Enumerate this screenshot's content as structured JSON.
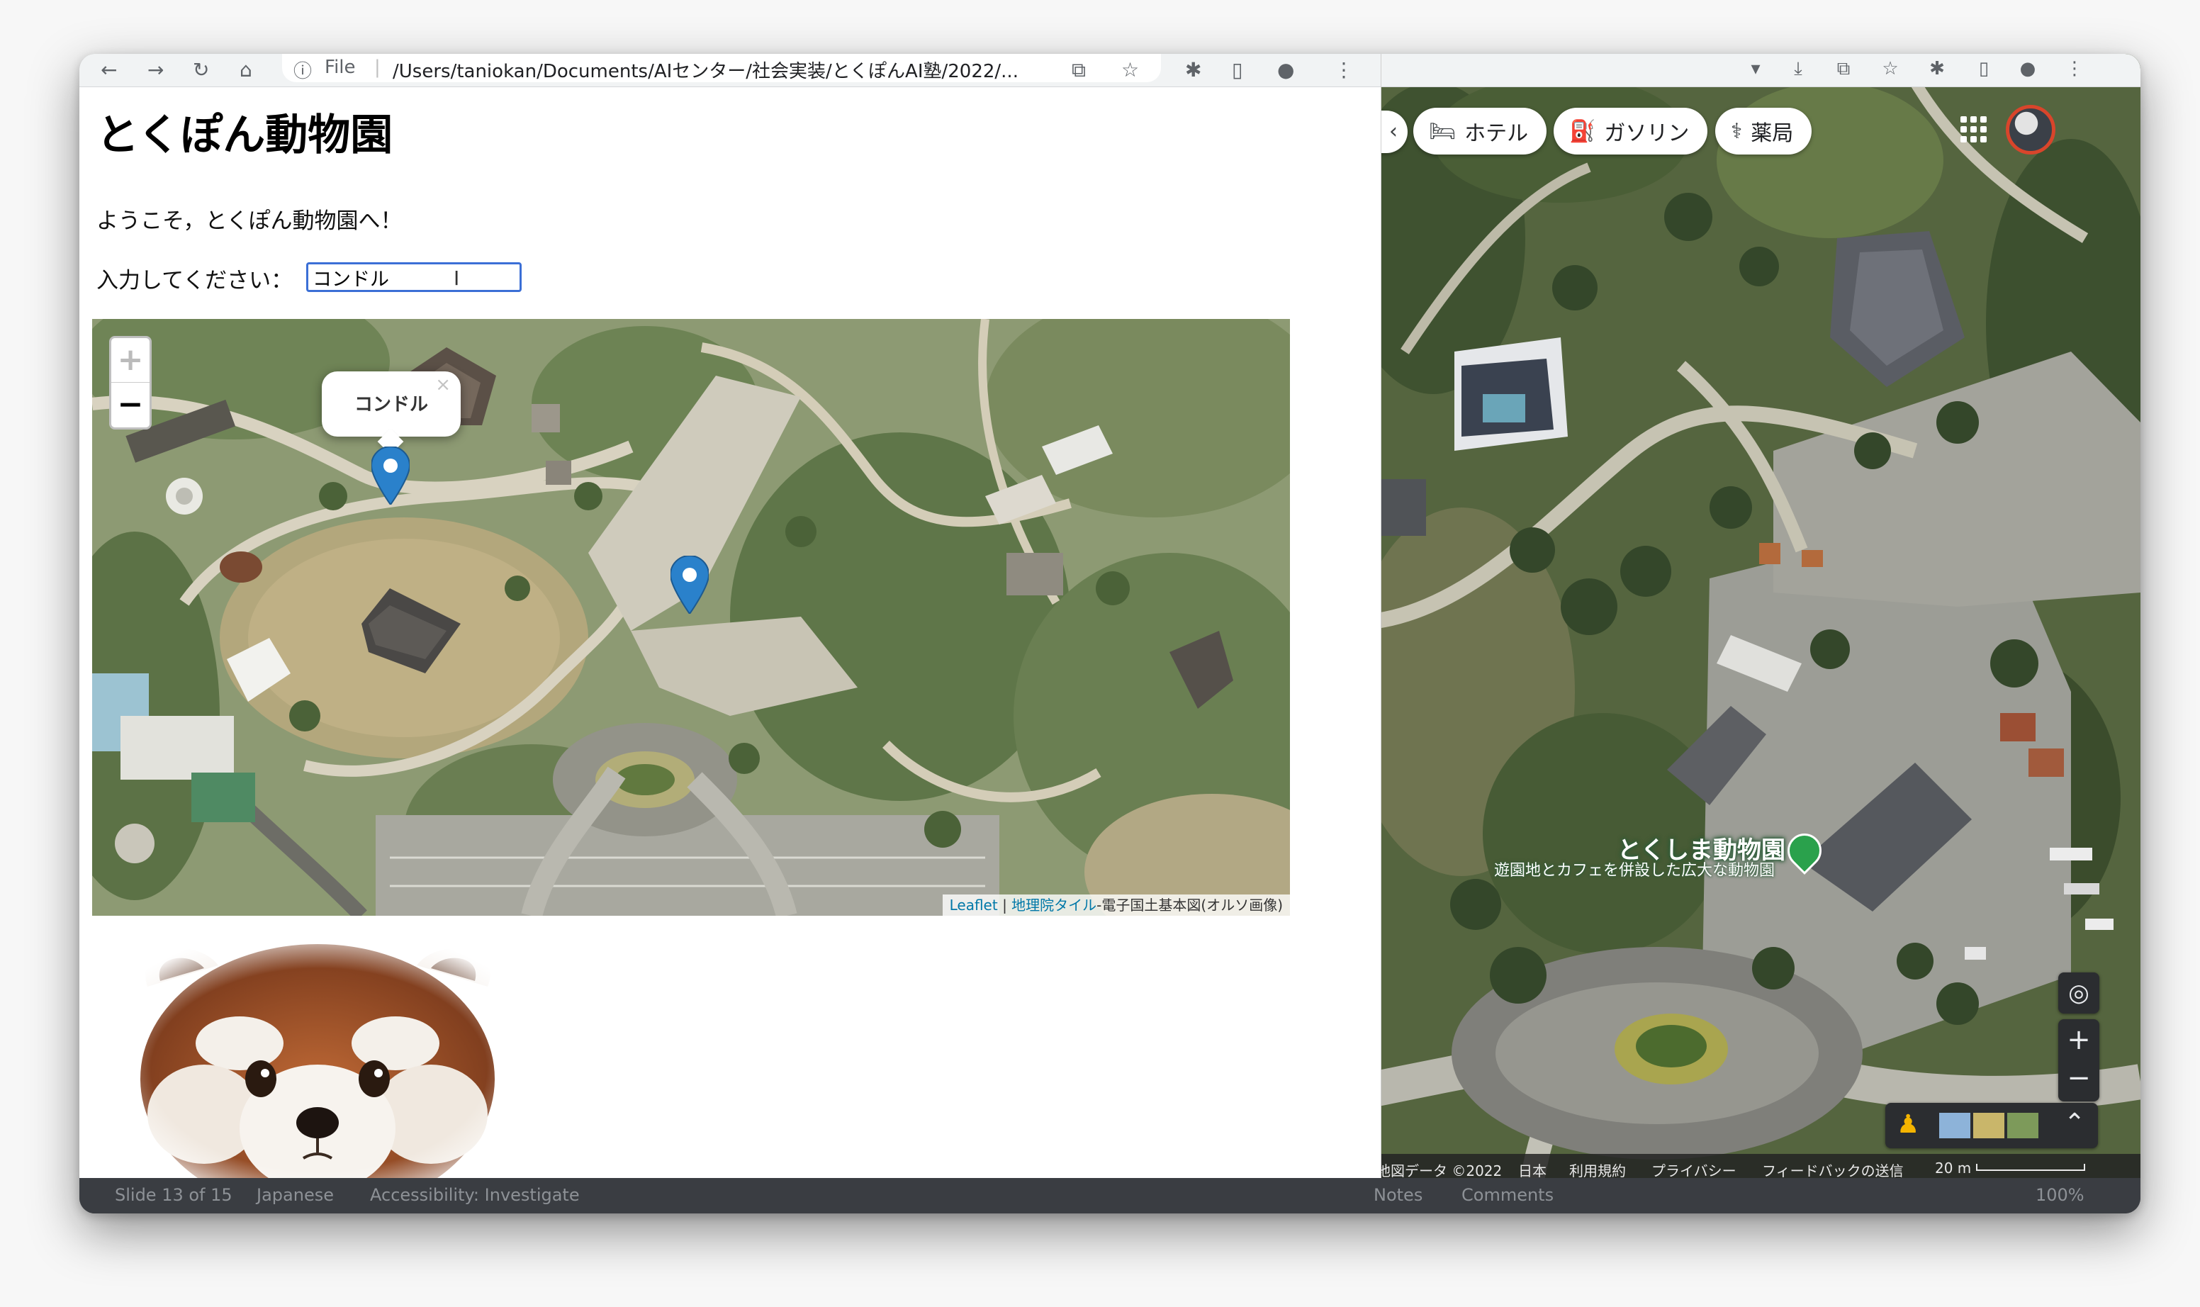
{
  "browser": {
    "omnibox": {
      "scheme_label": "File",
      "url": "/Users/taniokan/Documents/AIセンター/社会実装/とくぽんAI塾/2022/..."
    },
    "page": {
      "title": "とくぽん動物園",
      "welcome": "ようこそ，とくぽん動物園へ！",
      "input_label": "入力してください：",
      "input_value": "コンドル",
      "map": {
        "zoom_in": "+",
        "zoom_out": "−",
        "popup_text": "コンドル",
        "popup_close": "×",
        "markers": [
          "condor-marker",
          "zoo-center-marker"
        ],
        "attribution": {
          "leaflet": "Leaflet",
          "separator": " | ",
          "tiles": "地理院タイル",
          "rest": "-電子国土基本図(オルソ画像)"
        }
      },
      "image_subject": "red-panda"
    }
  },
  "google_maps": {
    "chips": [
      {
        "icon": "bed-icon",
        "glyph": "🛏",
        "label": "ホテル"
      },
      {
        "icon": "gas-station-icon",
        "glyph": "⛽",
        "label": "ガソリン"
      },
      {
        "icon": "pharmacy-icon",
        "glyph": "⚕",
        "label": "薬局"
      }
    ],
    "place": {
      "name": "とくしま動物園",
      "description": "遊園地とカフェを併設した広大な動物園"
    },
    "controls": {
      "zoom_in": "+",
      "zoom_out": "−"
    },
    "attribution": {
      "data": "地図データ ©2022",
      "country": "日本",
      "terms": "利用規約",
      "privacy": "プライバシー",
      "feedback": "フィードバックの送信",
      "scale": "20 m"
    }
  },
  "status_bar": {
    "slide": "Slide 13 of 15",
    "language": "Japanese",
    "accessibility": "Accessibility: Investigate",
    "notes": "Notes",
    "comments": "Comments",
    "zoom": "100%"
  },
  "colors": {
    "input_border": "#3b6fd6",
    "marker_blue": "#2a81cb",
    "place_pin": "#2aa14c",
    "avatar_ring": "#d9452b"
  }
}
